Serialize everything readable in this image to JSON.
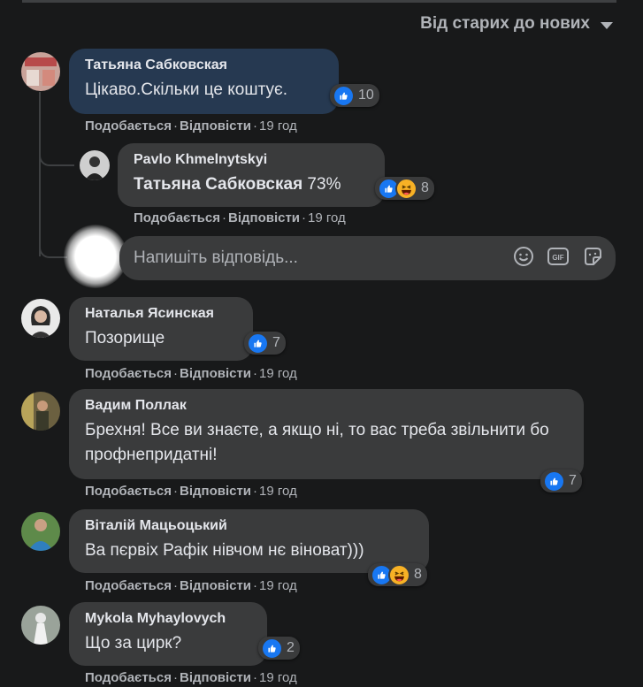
{
  "sort": {
    "label": "Від старих до нових"
  },
  "actions": {
    "like": "Подобається",
    "reply": "Відповісти",
    "sep": "·"
  },
  "reply_input": {
    "placeholder": "Напишіть відповідь..."
  },
  "comments": [
    {
      "author": "Татьяна Сабковская",
      "text": "Цікаво.Скільки це коштує.",
      "reactions": "10",
      "time": "19 год"
    },
    {
      "author": "Pavlo Khmelnytskyi",
      "mention": "Татьяна Сабковская",
      "text": " 73%",
      "reactions": "8",
      "time": "19 год"
    },
    {
      "author": "Наталья Ясинская",
      "text": "Позорище",
      "reactions": "7",
      "time": "19 год"
    },
    {
      "author": "Вадим Поллак",
      "text": "Брехня! Все ви знаєте, а якщо ні, то вас треба звільнити бо профнепридатні!",
      "reactions": "7",
      "time": "19 год"
    },
    {
      "author": "Віталій Мацьоцький",
      "text": "Ва пєрвіх Рафік нівчом нє віноват)))",
      "reactions": "8",
      "time": "19 год"
    },
    {
      "author": "Mykola Myhaylovych",
      "text": "Що за цирк?",
      "reactions": "2",
      "time": "19 год"
    }
  ],
  "colors": {
    "background": "#18191a",
    "bubble": "#3a3b3c",
    "highlight": "#263951",
    "like": "#1877f2",
    "haha": "#f7b125"
  }
}
